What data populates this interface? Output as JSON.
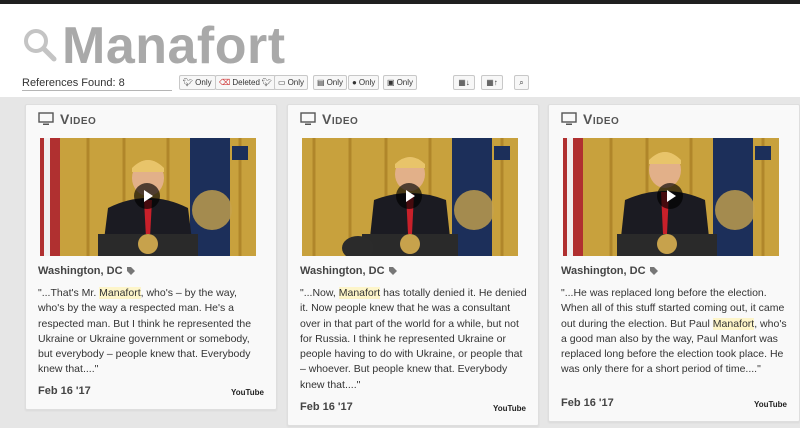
{
  "search": {
    "title": "Manafort"
  },
  "toolbar": {
    "refs_label": "References Found: 8",
    "filters": [
      {
        "label": "Only",
        "icon": "twitter-icon"
      },
      {
        "label": "Deleted",
        "icon": "deleted-twitter-icon"
      },
      {
        "label": "Only",
        "icon": "monitor-icon"
      },
      {
        "label": "Only",
        "icon": "document-icon"
      },
      {
        "label": "Only",
        "icon": "user-icon"
      },
      {
        "label": "Only",
        "icon": "caption-icon"
      }
    ]
  },
  "cards": [
    {
      "type_label": "Video",
      "location": "Washington, DC",
      "quote_before": "\"...That's Mr. ",
      "quote_highlight": "Manafort",
      "quote_after": ", who's – by the way, who's by the way a respected man. He's a respected man. But I think he represented the Ukraine or Ukraine government or somebody, but everybody – people knew that. Everybody knew that....\"",
      "date": "Feb 16 '17",
      "source": "YouTube"
    },
    {
      "type_label": "Video",
      "location": "Washington, DC",
      "quote_before": "\"...Now, ",
      "quote_highlight": "Manafort",
      "quote_after": " has totally denied it. He denied it. Now people knew that he was a consultant over in that part of the world for a while, but not for Russia. I think he represented Ukraine or people having to do with Ukraine, or people that – whoever. But people knew that. Everybody knew that....\"",
      "date": "Feb 16 '17",
      "source": "YouTube"
    },
    {
      "type_label": "Video",
      "location": "Washington, DC",
      "quote_before": "\"...He was replaced long before the election. When all of this stuff started coming out, it came out during the election. But Paul ",
      "quote_highlight": "Manafort",
      "quote_after": ", who's a good man also by the way, Paul Manfort was replaced long before the election took place. He was only there for a short period of time....\"",
      "date": "Feb 16 '17",
      "source": "YouTube"
    }
  ],
  "colors": {
    "title": "#a9a9a9",
    "highlight": "#fdf5c9",
    "curtain": "#c8a13d"
  }
}
